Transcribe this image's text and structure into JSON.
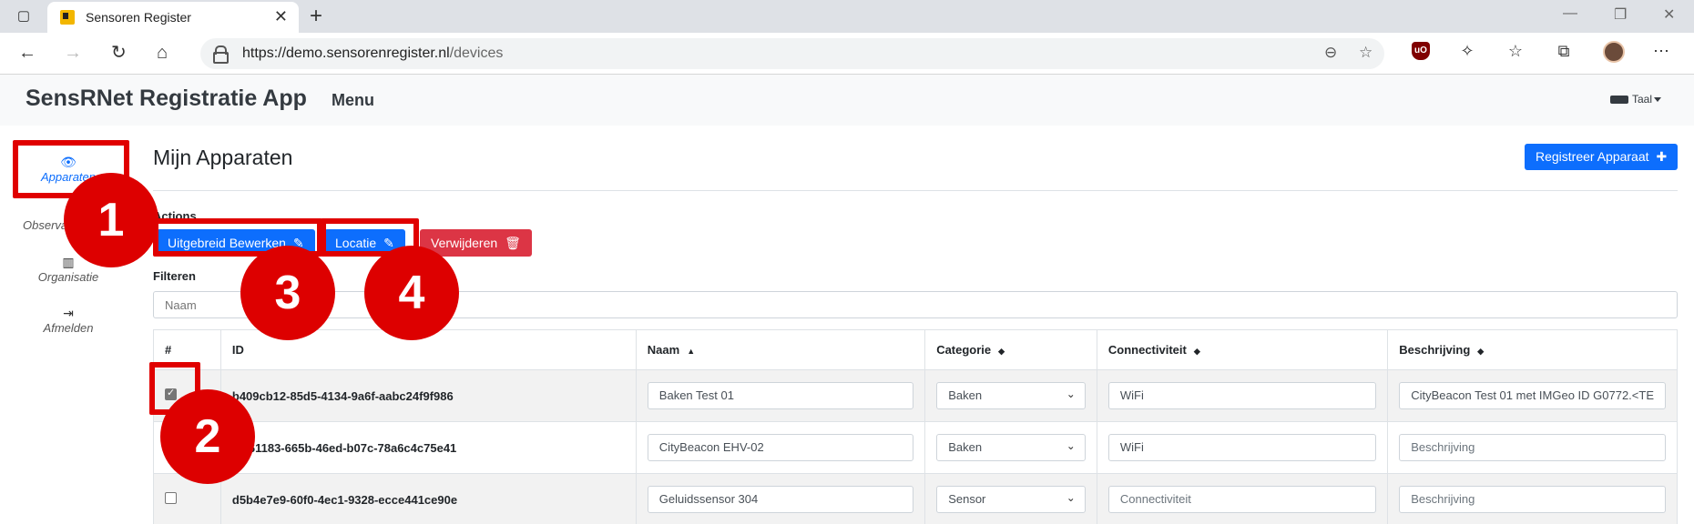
{
  "browser": {
    "tab_title": "Sensoren Register",
    "url_host": "https://demo.sensorenregister.nl",
    "url_path": "/devices"
  },
  "app": {
    "brand": "SensRNet Registratie App",
    "menu": "Menu",
    "language": "Taal"
  },
  "sidebar": {
    "items": [
      {
        "label": "Apparaten",
        "icon": "eye-icon",
        "active": true
      },
      {
        "label": "Observatiedoelen",
        "icon": "target-icon",
        "active": false
      },
      {
        "label": "Organisatie",
        "icon": "building-icon",
        "active": false
      },
      {
        "label": "Afmelden",
        "icon": "sign-out-icon",
        "active": false
      }
    ]
  },
  "main": {
    "title": "Mijn Apparaten",
    "register_button": "Registreer Apparaat",
    "actions_label": "Actions",
    "actions": {
      "edit": "Uitgebreid Bewerken",
      "location": "Locatie",
      "delete": "Verwijderen"
    },
    "filter_label": "Filteren",
    "filter_placeholder": "Naam"
  },
  "table": {
    "headers": [
      "#",
      "ID",
      "Naam",
      "Categorie",
      "Connectiviteit",
      "Beschrijving"
    ],
    "rows": [
      {
        "checked": true,
        "id": "b409cb12-85d5-4134-9a6f-aabc24f9f986",
        "name": "Baken Test 01",
        "category": "Baken",
        "connectivity": "WiFi",
        "description": "CityBeacon Test 01 met IMGeo ID G0772.<TE"
      },
      {
        "checked": false,
        "id": "61183-665b-46ed-b07c-78a6c4c75e41",
        "name": "CityBeacon EHV-02",
        "category": "Baken",
        "connectivity": "WiFi",
        "description": "Beschrijving"
      },
      {
        "checked": false,
        "id": "d5b4e7e9-60f0-4ec1-9328-ecce441ce90e",
        "name": "Geluidssensor 304",
        "category": "Sensor",
        "connectivity": "Connectiviteit",
        "description": "Beschrijving"
      }
    ]
  },
  "annotations": {
    "markers": [
      "1",
      "2",
      "3",
      "4"
    ],
    "color": "#dd0000"
  },
  "colors": {
    "primary": "#0d6efd",
    "danger": "#dc3545"
  }
}
